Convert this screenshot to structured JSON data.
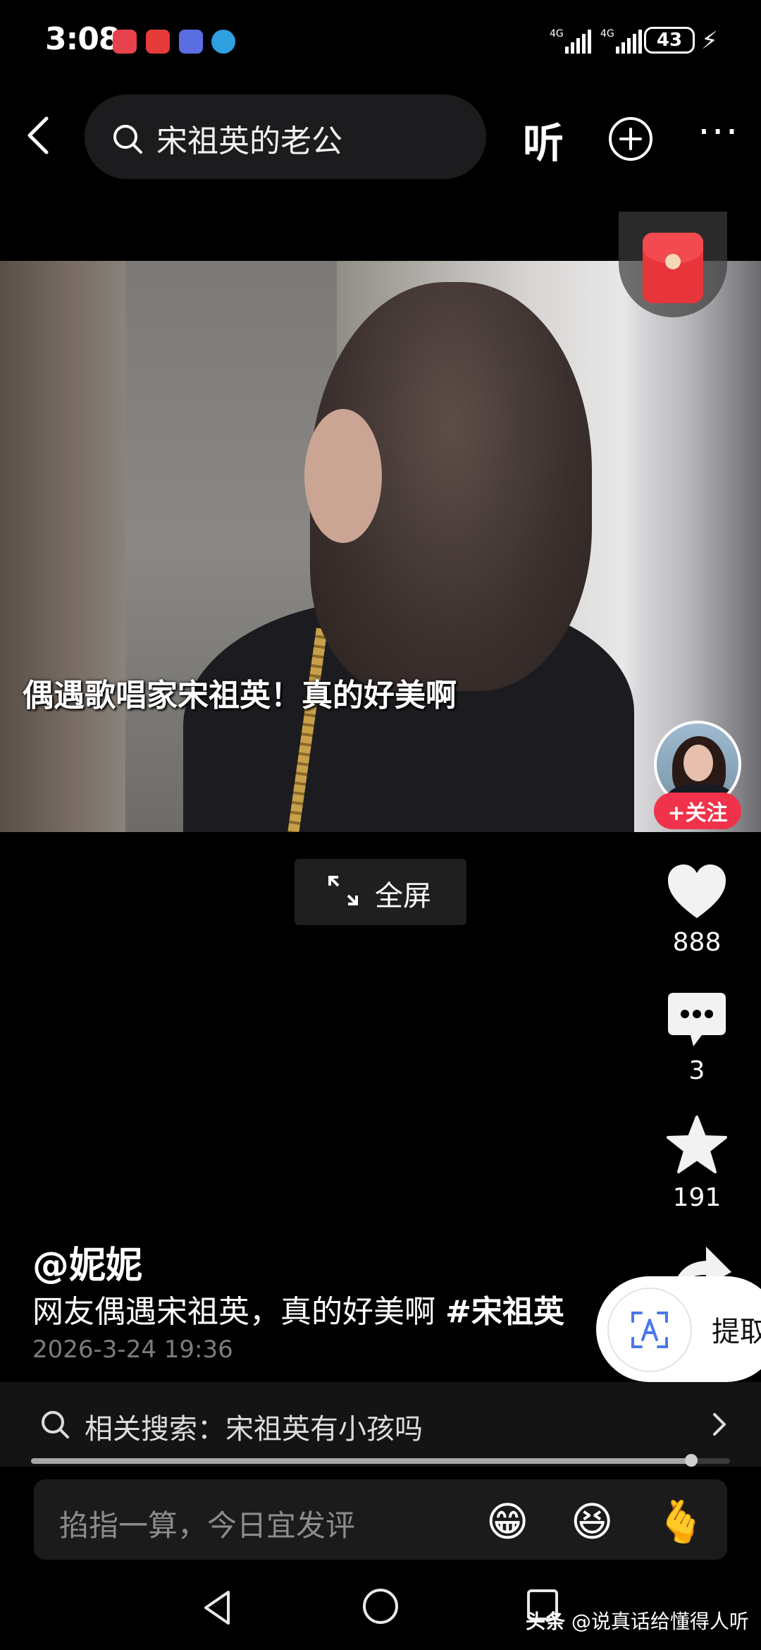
{
  "status_bar": {
    "time": "3:08",
    "network1": "4G",
    "network2": "4G",
    "battery": "43"
  },
  "header": {
    "search_query": "宋祖英的老公",
    "listen_label": "听"
  },
  "video": {
    "caption": "偶遇歌唱家宋祖英！真的好美啊",
    "follow_label": "+关注",
    "fullscreen_label": "全屏"
  },
  "actions": {
    "likes": "888",
    "comments": "3",
    "favorites": "191"
  },
  "post": {
    "author": "@妮妮",
    "description": "网友偶遇宋祖英，真的好美啊 ",
    "hashtag": "#宋祖英",
    "date": "2026-3-24 19:36"
  },
  "extract": {
    "label": "提取"
  },
  "related": {
    "label": "相关搜索：宋祖英有小孩吗"
  },
  "progress": {
    "fraction": 0.945
  },
  "comment_bar": {
    "placeholder": "掐指一算，今日宜发评",
    "emojis": [
      "😁",
      "😆",
      "🫰"
    ]
  },
  "watermark": {
    "brand": "头条",
    "account": " @说真话给懂得人听"
  },
  "colors": {
    "follow_red": "#f0334a",
    "envelope_red": "#e8343b",
    "background": "#000000"
  }
}
